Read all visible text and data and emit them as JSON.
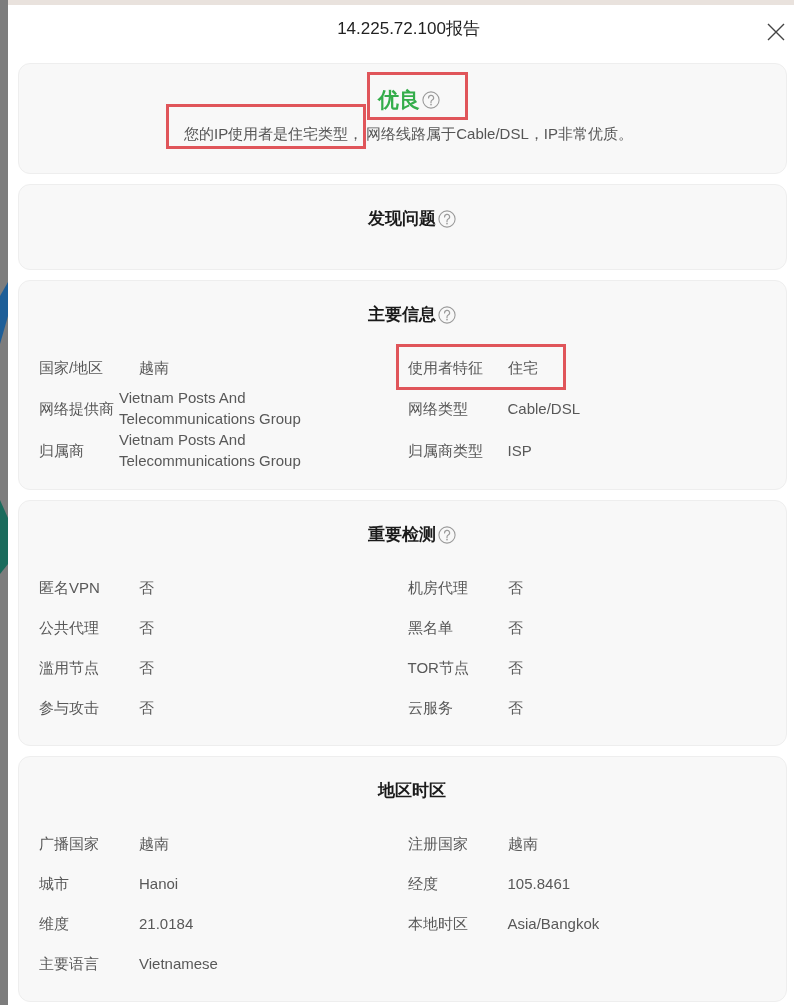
{
  "dialog": {
    "title": "14.225.72.100报告"
  },
  "summary": {
    "rating": "优良",
    "rating_highlighted": true,
    "help_icon": true,
    "description": [
      {
        "text": "您的IP使用者是住宅类型，",
        "highlighted": true
      },
      {
        "text": "网络线路属于Cable/DSL，IP非常优质。",
        "highlighted": false
      }
    ]
  },
  "sections": [
    {
      "title": "发现问题",
      "help_icon": true
    },
    {
      "title": "主要信息",
      "help_icon": true,
      "fields": [
        {
          "label": "国家/地区",
          "value": "越南",
          "highlighted": false
        },
        {
          "label": "使用者特征",
          "value": "住宅",
          "highlighted": true
        },
        {
          "label": "网络提供商",
          "value": "Vietnam Posts And Telecommunications Group",
          "highlighted": false
        },
        {
          "label": "网络类型",
          "value": "Cable/DSL",
          "highlighted": false
        },
        {
          "label": "归属商",
          "value": "Vietnam Posts And Telecommunications Group",
          "highlighted": false
        },
        {
          "label": "归属商类型",
          "value": "ISP",
          "highlighted": false
        }
      ]
    },
    {
      "title": "重要检测",
      "help_icon": true,
      "fields": [
        {
          "label": "匿名VPN",
          "value": "否",
          "highlighted": false
        },
        {
          "label": "机房代理",
          "value": "否",
          "highlighted": false
        },
        {
          "label": "公共代理",
          "value": "否",
          "highlighted": false
        },
        {
          "label": "黑名单",
          "value": "否",
          "highlighted": false
        },
        {
          "label": "滥用节点",
          "value": "否",
          "highlighted": false
        },
        {
          "label": "TOR节点",
          "value": "否",
          "highlighted": false
        },
        {
          "label": "参与攻击",
          "value": "否",
          "highlighted": false
        },
        {
          "label": "云服务",
          "value": "否",
          "highlighted": false
        }
      ]
    },
    {
      "title": "地区时区",
      "help_icon": false,
      "fields": [
        {
          "label": "广播国家",
          "value": "越南",
          "highlighted": false
        },
        {
          "label": "注册国家",
          "value": "越南",
          "highlighted": false
        },
        {
          "label": "城市",
          "value": "Hanoi",
          "highlighted": false
        },
        {
          "label": "经度",
          "value": "105.8461",
          "highlighted": false
        },
        {
          "label": "维度",
          "value": "21.0184",
          "highlighted": false
        },
        {
          "label": "本地时区",
          "value": "Asia/Bangkok",
          "highlighted": false
        },
        {
          "label": "主要语言",
          "value": "Vietnamese",
          "highlighted": false
        }
      ]
    }
  ]
}
